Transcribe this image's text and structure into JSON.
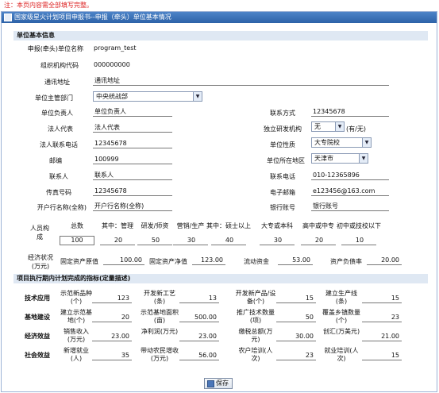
{
  "notice": "注：本页内容需全部填写完整。",
  "window_title": "国家级星火计划项目申报书--申报（牵头）单位基本情况",
  "section1_title": "单位基本信息",
  "fields": {
    "org_name_label": "申报(牵头)单位名称",
    "org_name": "program_test",
    "org_code_label": "组织机构代码",
    "org_code": "000000000",
    "address_label": "通讯地址",
    "address": "通讯地址",
    "dept_label": "单位主管部门",
    "dept": "中央统战部",
    "head_label": "单位负责人",
    "head": "单位负责人",
    "contact_label": "联系方式",
    "contact": "12345678",
    "legal_label": "法人代表",
    "legal": "法人代表",
    "rd_label": "独立研发机构",
    "rd": "无",
    "rd_suffix": "(有/无)",
    "legal_phone_label": "法人联系电话",
    "legal_phone": "12345678",
    "nature_label": "单位性质",
    "nature": "大专院校",
    "postcode_label": "邮编",
    "postcode": "100999",
    "region_label": "单位所在地区",
    "region": "天津市",
    "liaison_label": "联系人",
    "liaison": "联系人",
    "liaison_phone_label": "联系电话",
    "liaison_phone": "010-12365896",
    "fax_label": "传真号码",
    "fax": "12345678",
    "email_label": "电子邮箱",
    "email": "e123456@163.com",
    "bank_name_label": "开户行名称(全称)",
    "bank_name": "开户行名称(全称)",
    "bank_acct_label": "银行账号",
    "bank_acct": "银行账号"
  },
  "staff": {
    "label": "人员构成",
    "headers": [
      "总数",
      "其中：管理",
      "研发/师资",
      "营销/生产",
      "其中：硕士以上",
      "大专或本科",
      "高中或中专",
      "初中或技校以下"
    ],
    "values": [
      "100",
      "20",
      "50",
      "30",
      "40",
      "30",
      "20",
      "10"
    ]
  },
  "finance": {
    "label": "经济状况(万元)",
    "fixed_orig_label": "固定资产原值",
    "fixed_orig": "100.00",
    "fixed_net_label": "固定资产净值",
    "fixed_net": "123.00",
    "liquid_label": "流动资金",
    "liquid": "53.00",
    "debt_label": "资产负债率",
    "debt": "20.00"
  },
  "section2_title": "项目执行期内计划完成的指标(定量描述)",
  "indicators": [
    {
      "category": "技术应用",
      "items": [
        {
          "label": "示范新品种(个)",
          "value": "123"
        },
        {
          "label": "开发新工艺(条)",
          "value": "13"
        },
        {
          "label": "开发新产品/设备(个)",
          "value": "15"
        },
        {
          "label": "建立生产线(条)",
          "value": "15"
        }
      ]
    },
    {
      "category": "基地建设",
      "items": [
        {
          "label": "建立示范基地(个)",
          "value": "20"
        },
        {
          "label": "示范基地面积(亩)",
          "value": "500.00"
        },
        {
          "label": "推广技术数量(项)",
          "value": "50"
        },
        {
          "label": "覆盖乡镇数量(个)",
          "value": "23"
        }
      ]
    },
    {
      "category": "经济效益",
      "items": [
        {
          "label": "销售收入(万元)",
          "value": "23.00"
        },
        {
          "label": "净利润(万元)",
          "value": "23.00"
        },
        {
          "label": "缴税总额(万元)",
          "value": "30.00"
        },
        {
          "label": "创汇(万美元)",
          "value": "21.00"
        }
      ]
    },
    {
      "category": "社会效益",
      "items": [
        {
          "label": "新增就业(人)",
          "value": "35"
        },
        {
          "label": "带动农民增收(万元)",
          "value": "56.00"
        },
        {
          "label": "农户培训(人次)",
          "value": "23"
        },
        {
          "label": "就业培训(人次)",
          "value": "15"
        }
      ]
    }
  ],
  "save_label": "保存",
  "icons": {
    "title": "form-icon",
    "save": "disk-icon",
    "dropdown": "chevron-down-icon"
  }
}
